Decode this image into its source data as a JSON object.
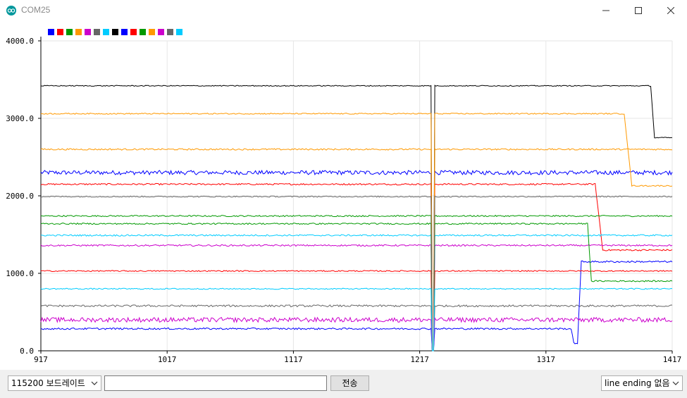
{
  "window": {
    "title": "COM25",
    "icons": {
      "app": "arduino-logo-icon",
      "minimize": "minimize-icon",
      "maximize": "maximize-icon",
      "close": "close-icon"
    }
  },
  "controls": {
    "baud_rate": "115200 보드레이트",
    "send_input_value": "",
    "send_label": "전송",
    "line_ending": "line ending 없음"
  },
  "chart_data": {
    "type": "line",
    "xlim": [
      917,
      1417
    ],
    "ylim": [
      0,
      4000
    ],
    "x_ticks": [
      "917",
      "1017",
      "1117",
      "1217",
      "1317",
      "1417"
    ],
    "y_ticks": [
      "0.0",
      "1000.0",
      "2000.0",
      "3000.0",
      "4000.0"
    ],
    "grid": true,
    "legend": "top-left",
    "dropout_x": 1227,
    "series": [
      {
        "color": "#0000ff",
        "noise": 55,
        "segments": [
          [
            917,
            2300
          ],
          [
            1417,
            2300
          ]
        ]
      },
      {
        "color": "#ff0000",
        "noise": 20,
        "segments": [
          [
            917,
            2150
          ],
          [
            1356,
            2150
          ],
          [
            1362,
            1300
          ],
          [
            1417,
            1300
          ]
        ]
      },
      {
        "color": "#009900",
        "noise": 18,
        "segments": [
          [
            917,
            1740
          ],
          [
            1417,
            1740
          ]
        ]
      },
      {
        "color": "#ff9900",
        "noise": 20,
        "segments": [
          [
            917,
            2600
          ],
          [
            1417,
            2600
          ]
        ]
      },
      {
        "color": "#cc00cc",
        "noise": 20,
        "segments": [
          [
            917,
            1360
          ],
          [
            1417,
            1360
          ]
        ]
      },
      {
        "color": "#666666",
        "noise": 25,
        "segments": [
          [
            917,
            580
          ],
          [
            1417,
            580
          ]
        ]
      },
      {
        "color": "#00ccff",
        "noise": 20,
        "segments": [
          [
            917,
            1490
          ],
          [
            1417,
            1490
          ]
        ]
      },
      {
        "color": "#000000",
        "noise": 12,
        "segments": [
          [
            917,
            3420
          ],
          [
            1400,
            3420
          ],
          [
            1403,
            2750
          ],
          [
            1417,
            2750
          ]
        ]
      },
      {
        "color": "#0000ff",
        "noise": 22,
        "segments": [
          [
            917,
            285
          ],
          [
            1337,
            285
          ],
          [
            1339,
            100
          ],
          [
            1342,
            100
          ],
          [
            1345,
            1150
          ],
          [
            1417,
            1150
          ]
        ]
      },
      {
        "color": "#ff0000",
        "noise": 15,
        "segments": [
          [
            917,
            1030
          ],
          [
            1417,
            1030
          ]
        ]
      },
      {
        "color": "#009900",
        "noise": 18,
        "segments": [
          [
            917,
            1640
          ],
          [
            1350,
            1640
          ],
          [
            1353,
            900
          ],
          [
            1417,
            900
          ]
        ]
      },
      {
        "color": "#ff9900",
        "noise": 15,
        "segments": [
          [
            917,
            3060
          ],
          [
            1379,
            3060
          ],
          [
            1385,
            2130
          ],
          [
            1417,
            2130
          ]
        ]
      },
      {
        "color": "#cc00cc",
        "noise": 60,
        "segments": [
          [
            917,
            400
          ],
          [
            1417,
            400
          ]
        ]
      },
      {
        "color": "#666666",
        "noise": 15,
        "segments": [
          [
            917,
            1990
          ],
          [
            1417,
            1990
          ]
        ]
      },
      {
        "color": "#00ccff",
        "noise": 15,
        "segments": [
          [
            917,
            800
          ],
          [
            1417,
            800
          ]
        ]
      }
    ]
  }
}
